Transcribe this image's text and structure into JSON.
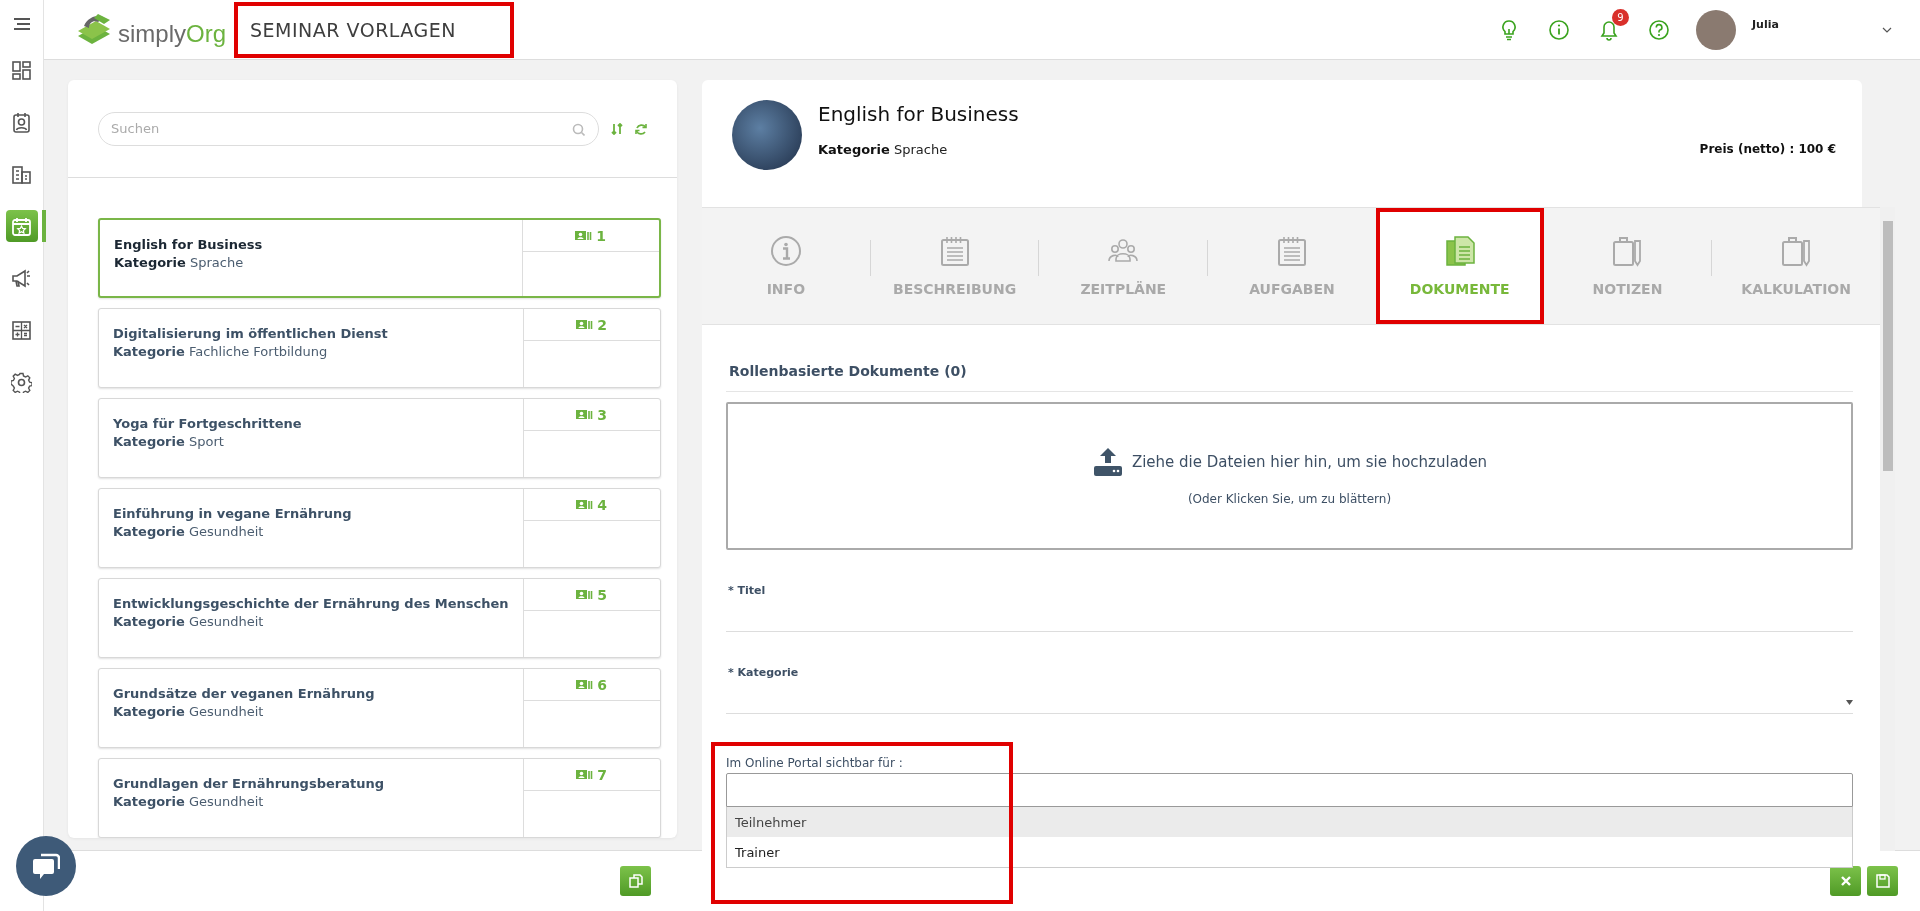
{
  "nav": {
    "items": [
      {
        "kind": "dashboard",
        "selected": false
      },
      {
        "kind": "contact",
        "selected": false
      },
      {
        "kind": "building",
        "selected": false
      },
      {
        "kind": "calendar",
        "selected": true
      },
      {
        "kind": "megaphone",
        "selected": false
      },
      {
        "kind": "calculator",
        "selected": false
      },
      {
        "kind": "settings",
        "selected": false
      }
    ]
  },
  "header": {
    "logo": {
      "part_1": "simply",
      "part_2": "Org"
    },
    "page_title": "SEMINAR VORLAGEN",
    "page_title_annotated": true,
    "notification_count": "9",
    "user_name": "Julia"
  },
  "search": {
    "placeholder": "Suchen"
  },
  "seminars": [
    {
      "title": "English for Business",
      "category_label": "Kategorie",
      "category": "Sprache",
      "number": "1",
      "selected": true
    },
    {
      "title": "Digitalisierung im öffentlichen Dienst",
      "category_label": "Kategorie",
      "category": "Fachliche Fortbildung",
      "number": "2",
      "selected": false
    },
    {
      "title": "Yoga für Fortgeschrittene",
      "category_label": "Kategorie",
      "category": "Sport",
      "number": "3",
      "selected": false
    },
    {
      "title": "Einführung in vegane Ernährung",
      "category_label": "Kategorie",
      "category": "Gesundheit",
      "number": "4",
      "selected": false
    },
    {
      "title": "Entwicklungsgeschichte der Ernährung des Menschen",
      "category_label": "Kategorie",
      "category": "Gesundheit",
      "number": "5",
      "selected": false
    },
    {
      "title": "Grundsätze der veganen Ernährung",
      "category_label": "Kategorie",
      "category": "Gesundheit",
      "number": "6",
      "selected": false
    },
    {
      "title": "Grundlagen der Ernährungsberatung",
      "category_label": "Kategorie",
      "category": "Gesundheit",
      "number": "7",
      "selected": false
    }
  ],
  "detail": {
    "title": "English for Business",
    "category_label": "Kategorie",
    "category": "Sprache",
    "price": "Preis (netto) : 100 €"
  },
  "tabs": [
    {
      "label": "INFO",
      "kind": "info",
      "selected": false,
      "annotated": false
    },
    {
      "label": "BESCHREIBUNG",
      "kind": "notepad",
      "selected": false,
      "annotated": false
    },
    {
      "label": "ZEITPLÄNE",
      "kind": "people",
      "selected": false,
      "annotated": false
    },
    {
      "label": "AUFGABEN",
      "kind": "notepad",
      "selected": false,
      "annotated": false
    },
    {
      "label": "DOKUMENTE",
      "kind": "documents",
      "selected": true,
      "annotated": true
    },
    {
      "label": "NOTIZEN",
      "kind": "clipboard",
      "selected": false,
      "annotated": false
    },
    {
      "label": "KALKULATION",
      "kind": "clipboard",
      "selected": false,
      "annotated": false
    }
  ],
  "documents": {
    "heading": "Rollenbasierte Dokumente (0)",
    "dropzone": {
      "text": "Ziehe die Dateien hier hin, um sie hochzuladen",
      "hint": "(Oder Klicken Sie, um zu blättern)"
    },
    "fields": [
      {
        "label": "* Titel",
        "kind": "text"
      },
      {
        "label": "* Kategorie",
        "kind": "select"
      }
    ],
    "portal": {
      "label": "Im Online Portal sichtbar für :",
      "annotated": true,
      "options": [
        {
          "label": "Teilnehmer",
          "highlighted": true
        },
        {
          "label": "Trainer",
          "highlighted": false
        }
      ]
    }
  }
}
